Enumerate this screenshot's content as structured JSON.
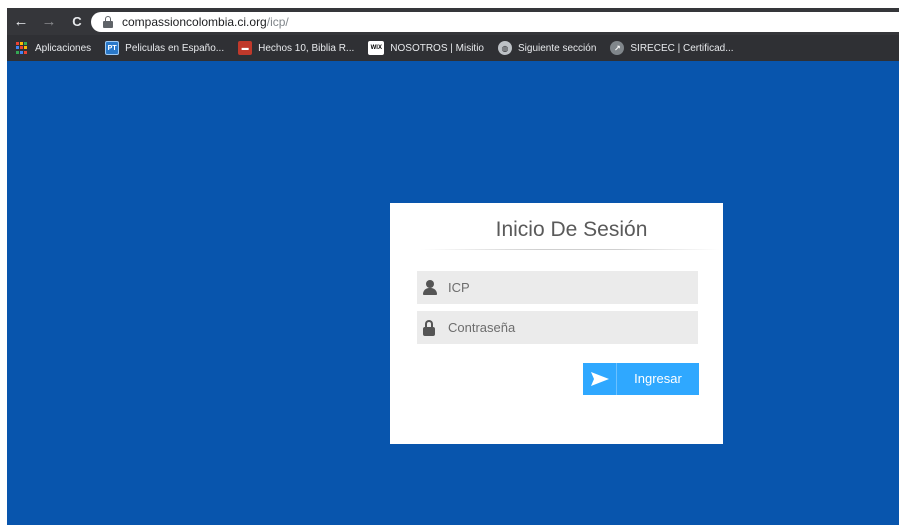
{
  "browser": {
    "url_host": "compassioncolombia.ci.org",
    "url_path": "/icp/",
    "nav": {
      "back_glyph": "←",
      "forward_glyph": "→",
      "reload_glyph": "C"
    }
  },
  "bookmarks": [
    {
      "label": "Aplicaciones",
      "icon": "apps-grid-icon"
    },
    {
      "label": "Peliculas en Españo...",
      "icon": "pt-icon",
      "icon_text": "PT"
    },
    {
      "label": "Hechos 10, Biblia R...",
      "icon": "book-icon",
      "icon_text": "▬"
    },
    {
      "label": "NOSOTROS | Misitio",
      "icon": "wix-icon",
      "icon_text": "WIX"
    },
    {
      "label": "Siguiente sección",
      "icon": "globe-icon",
      "icon_text": "◍"
    },
    {
      "label": "SIRECEC | Certificad...",
      "icon": "compass-icon",
      "icon_text": "↗"
    }
  ],
  "login": {
    "title": "Inicio De Sesión",
    "user_placeholder": "ICP",
    "user_value": "",
    "password_placeholder": "Contraseña",
    "password_value": "",
    "submit_label": "Ingresar"
  },
  "colors": {
    "page_background": "#0855ad",
    "button": "#2fa8ff",
    "field_background": "#ebebeb",
    "apps_icon": [
      "#ea4335",
      "#fbbc04",
      "#34a853",
      "#4285f4"
    ]
  }
}
